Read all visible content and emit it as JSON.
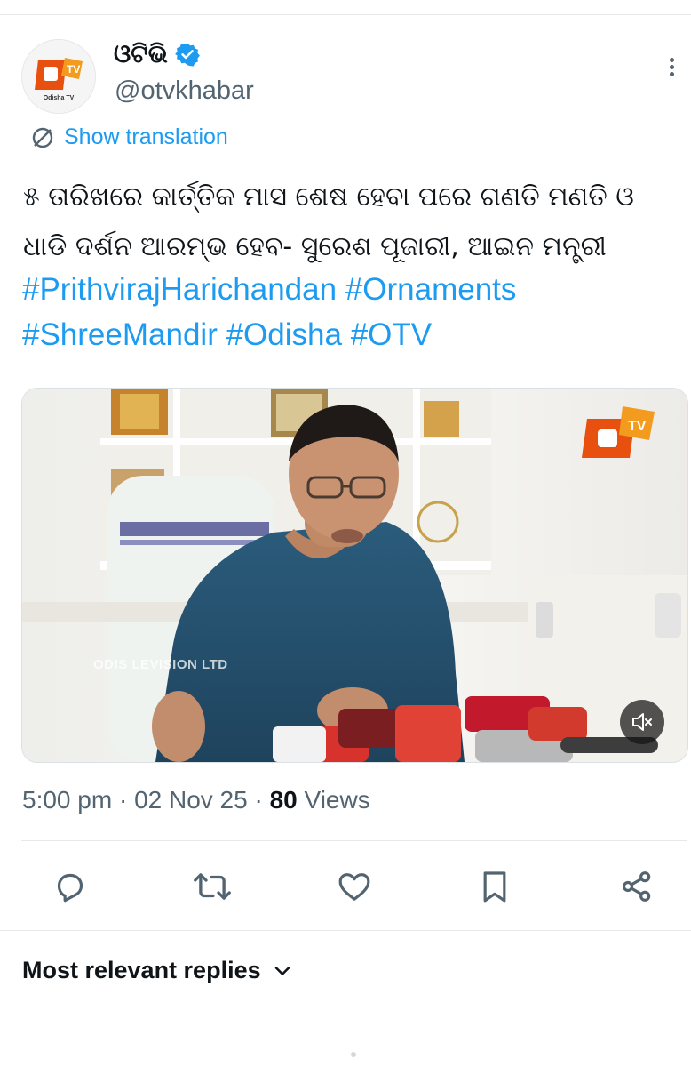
{
  "tweet": {
    "author": {
      "display_name": "ଓଟିଭି",
      "handle": "@otvkhabar",
      "verified": true,
      "avatar_caption": "Odisha TV"
    },
    "show_translation_label": "Show translation",
    "text_lines": [
      "୫ ତାରିଖରେ କାର୍ତ୍ତିକ ମାସ ଶେଷ ହେବା ପରେ ଗଣତି ମଣତି ଓ",
      "ଧାଡି ଦର୍ଶନ ଆରମ୍ଭ ହେବ- ସୁରେଶ ପୂଜାରୀ, ଆଇନ ମନ୍ତ୍ରୀ"
    ],
    "hashtags": [
      "#PrithvirajHarichandan",
      "#Ornaments",
      "#ShreeMandir",
      "#Odisha",
      "#OTV"
    ],
    "media": {
      "channel_logo_text": "TV",
      "watermark_text": "ODIS        LEVISION LTD",
      "muted": true
    },
    "meta": {
      "time": "5:00 pm",
      "separator": "·",
      "date": "02 Nov 25",
      "views_count": "80",
      "views_label": "Views"
    },
    "actions": [
      "reply",
      "retweet",
      "like",
      "bookmark",
      "share"
    ]
  },
  "replies": {
    "sort_label": "Most relevant replies"
  },
  "colors": {
    "accent": "#1d9bf0",
    "secondary_text": "#536471",
    "primary_text": "#0f1419",
    "brand_orange": "#e8500f"
  }
}
